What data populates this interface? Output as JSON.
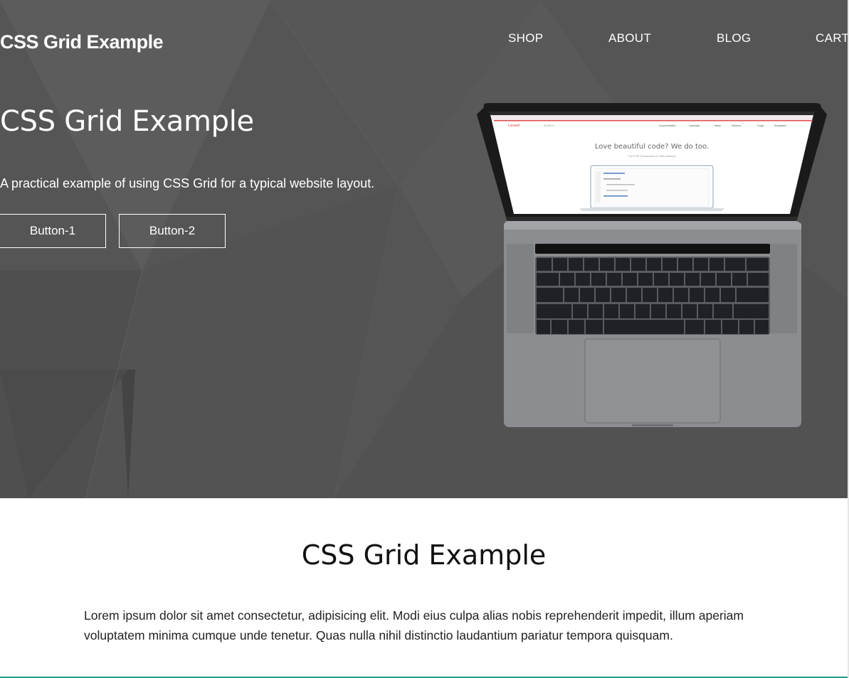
{
  "header": {
    "logo": "CSS Grid Example",
    "nav": [
      "SHOP",
      "ABOUT",
      "BLOG",
      "CART"
    ]
  },
  "hero": {
    "title": "CSS Grid Example",
    "subtitle": "A practical example of using CSS Grid for a typical website layout.",
    "buttons": [
      "Button-1",
      "Button-2"
    ],
    "image": {
      "screen_heading": "Love beautiful code? We do too.",
      "screen_subheading": "The PHP Framework for Web Artisans",
      "screen_brand": "Laravel",
      "screen_nav": [
        "Documentation",
        "Laracasts",
        "News",
        "Partners",
        "Forge",
        "Ecosystem"
      ],
      "search_placeholder": "SEARCH"
    }
  },
  "content": {
    "title": "CSS Grid Example",
    "text": "Lorem ipsum dolor sit amet consectetur, adipisicing elit. Modi eius culpa alias nobis reprehenderit impedit, illum aperiam voluptatem minima cumque unde tenetur. Quas nulla nihil distinctio laudantium pariatur tempora quisquam."
  },
  "colors": {
    "hero_bg": "#555555",
    "text_light": "#ffffff",
    "accent_line": "#1c9c8c"
  }
}
